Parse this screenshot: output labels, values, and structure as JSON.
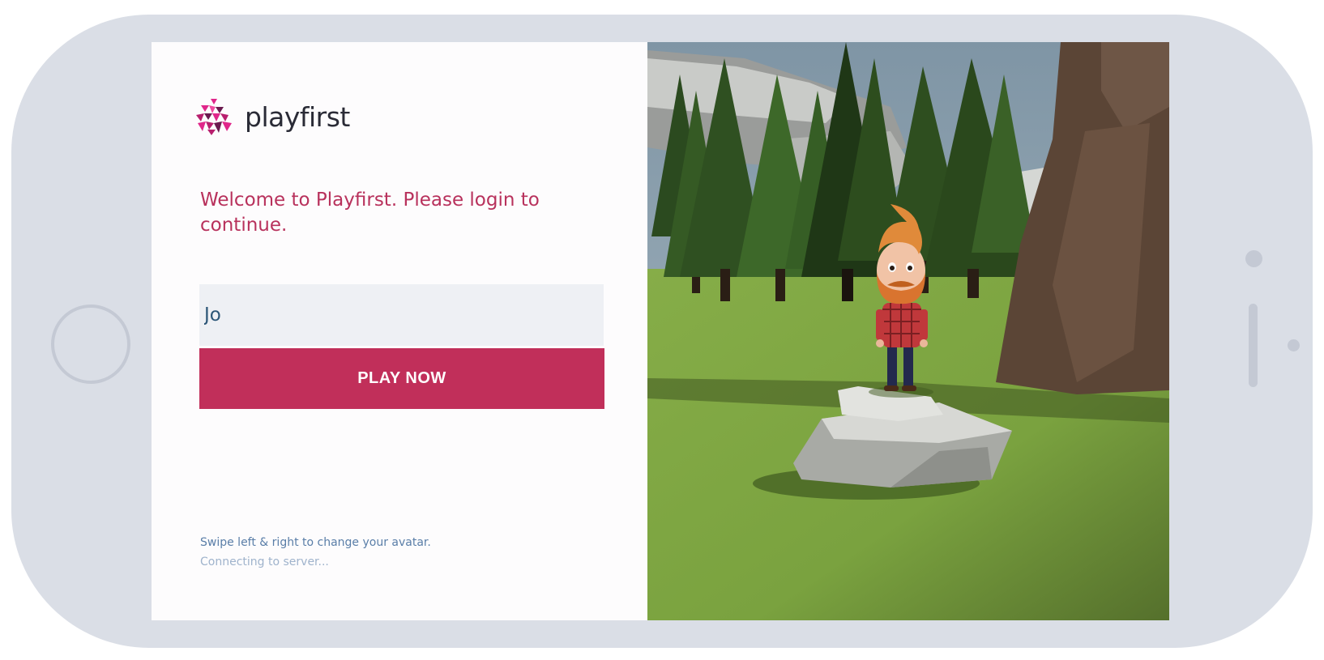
{
  "device": {
    "home_button_icon": "home-button-icon",
    "camera_icon": "camera-icon",
    "speaker_icon": "speaker-icon",
    "sensor_icon": "sensor-icon"
  },
  "brand": {
    "name": "playfirst",
    "logo_icon": "cube-cluster-logo-icon",
    "accent_color": "#c12f5a",
    "logo_colors": [
      "#e0268a",
      "#b81f6e",
      "#6b1a4f"
    ]
  },
  "login": {
    "welcome": "Welcome to Playfirst. Please login to continue.",
    "name_value": "Jo",
    "play_button_label": "PLAY NOW",
    "hint": "Swipe left & right to change your avatar.",
    "status": "Connecting to server..."
  },
  "avatar_scene": {
    "avatar": "red-bearded-lumberjack-avatar",
    "setting": "forest-clearing-with-rock"
  }
}
